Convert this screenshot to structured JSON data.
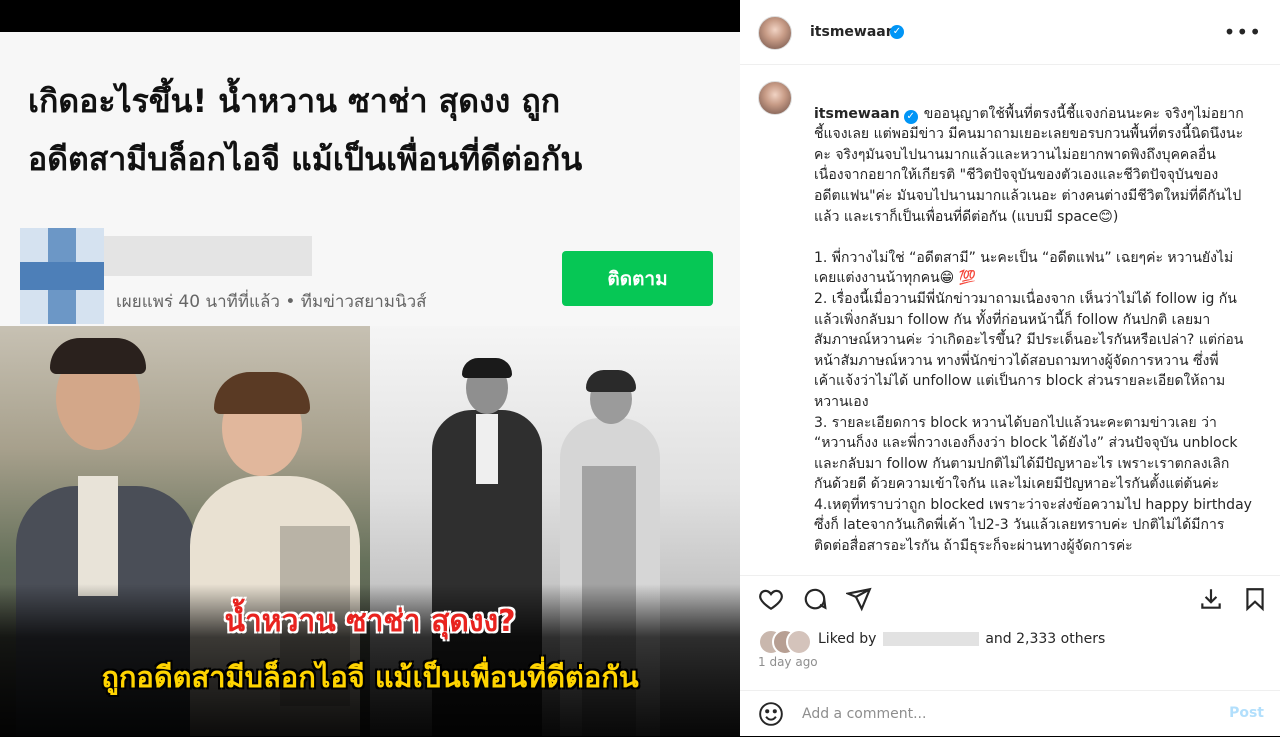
{
  "article": {
    "headline": "เกิดอะไรขึ้น! น้ำหวาน ซาช่า สุดงง ถูก\nอดีตสามีบล็อกไอจี แม้เป็นเพื่อนที่ดีต่อกัน",
    "meta": "เผยแพร่ 40 นาทีที่แล้ว • ทีมข่าวสยามนิวส์",
    "follow_label": "ติดตาม",
    "follow_color": "#06c755"
  },
  "image_caption": {
    "line1": "น้ำหวาน ซาช่า สุดงง?",
    "line2": "ถูกอดีตสามีบล็อกไอจี แม้เป็นเพื่อนที่ดีต่อกัน"
  },
  "post": {
    "username": "itsmewaan",
    "verified_icon": "verified-badge-icon",
    "more_icon": "more-options-icon",
    "caption": "ขออนุญาตใช้พื้นที่ตรงนี้ชี้แจงก่อนนะคะ จริงๆไม่อยาก\nชี้แจงเลย แต่พอมีข่าว มีคนมาถามเยอะเลยขอรบกวนพื้นที่ตรงนี้นิดนึงนะ\nคะ จริงๆมันจบไปนานมากแล้วและหวานไม่อยากพาดพิงถึงบุคคลอื่น\nเนื่องจากอยากให้เกียรติ \"ชีวิตปัจจุบันของตัวเองและชีวิตปัจจุบันของ\nอดีตแฟน\"ค่ะ มันจบไปนานมากแล้วเนอะ ต่างคนต่างมีชีวิตใหม่ที่ดีกันไป\nแล้ว และเราก็เป็นเพื่อนที่ดีต่อกัน (แบบมี space😊)\n\n1. พี่กวางไม่ใช่ “อดีตสามี” นะคะเป็น “อดีตแฟน” เฉยๆค่ะ หวานยังไม่\nเคยแต่งงานน้าทุกคน😁 💯\n2. เรื่องนี้เมื่อวานมีพี่นักข่าวมาถามเนื่องจาก เห็นว่าไม่ได้ follow ig กัน\nแล้วเพิ่งกลับมา follow กัน ทั้งที่ก่อนหน้านี้ก็ follow กันปกติ เลยมา\nสัมภาษณ์หวานค่ะ ว่าเกิดอะไรขึ้น? มีประเด็นอะไรกันหรือเปล่า? แต่ก่อน\nหน้าสัมภาษณ์หวาน ทางพี่นักข่าวได้สอบถามทางผู้จัดการหวาน ซึ่งพี่\nเค้าแจ้งว่าไม่ได้ unfollow แต่เป็นการ block ส่วนรายละเอียดให้ถาม\nหวานเอง\n3. รายละเอียดการ block หวานได้บอกไปแล้วนะคะตามข่าวเลย ว่า\n“หวานก็งง และพี่กวางเองก็งงว่า block ได้ยังไง” ส่วนปัจจุบัน unblock\nและกลับมา follow กันตามปกติไม่ได้มีปัญหาอะไร เพราะเราตกลงเลิก\nกันด้วยดี ด้วยความเข้าใจกัน และไม่เคยมีปัญหาอะไรกันตั้งแต่ต้นค่ะ\n4.เหตุที่ทราบว่าถูก blocked เพราะว่าจะส่งข้อความไป happy birthday\nซึ่งก็ lateจากวันเกิดพี่เค้า ไป2-3 วันแล้วเลยทราบค่ะ ปกติไม่ได้มีการ\nติดต่อสื่อสารอะไรกัน ถ้ามีธุระก็จะผ่านทางผู้จัดการค่ะ\n\nขอบคุณค่ะ\nหวาน♥",
    "liked_prefix": "Liked by",
    "liked_suffix": "and 2,333 others",
    "time": "1 day ago",
    "comment_placeholder": "Add a comment...",
    "post_label": "Post",
    "post_color": "#b2dffc"
  },
  "icons": {
    "like": "heart-icon",
    "comment": "comment-icon",
    "share": "share-icon",
    "download": "download-icon",
    "save": "bookmark-icon",
    "emoji": "emoji-icon"
  }
}
